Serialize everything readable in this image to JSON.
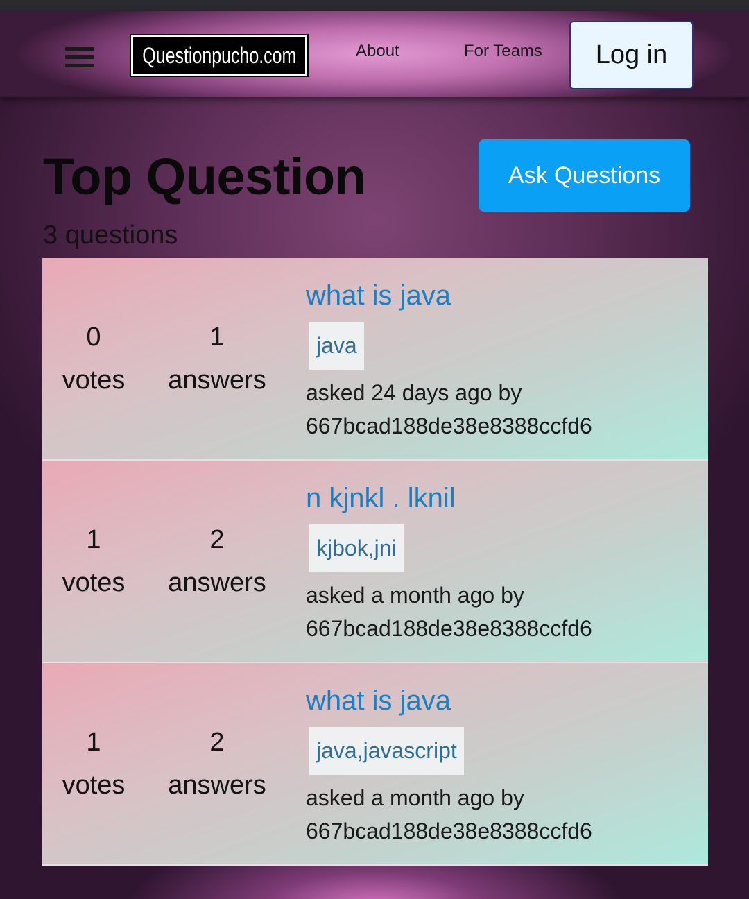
{
  "nav": {
    "logo": "Questionpucho.com",
    "links": [
      "About",
      "For Teams"
    ],
    "login_label": "Log in"
  },
  "main": {
    "title": "Top Question",
    "count_text": "3 questions",
    "ask_label": "Ask Questions"
  },
  "questions": [
    {
      "votes": "0",
      "votes_label": "votes",
      "answers": "1",
      "answers_label": "answers",
      "title": "what is java",
      "tags": "java",
      "asked": "asked 24 days ago by",
      "user": "667bcad188de38e8388ccfd6"
    },
    {
      "votes": "1",
      "votes_label": "votes",
      "answers": "2",
      "answers_label": "answers",
      "title": "n kjnkl . lknil",
      "tags": "kjbok,jni",
      "asked": "asked a month ago by",
      "user": "667bcad188de38e8388ccfd6"
    },
    {
      "votes": "1",
      "votes_label": "votes",
      "answers": "2",
      "answers_label": "answers",
      "title": "what is java",
      "tags": "java,javascript",
      "asked": "asked a month ago by",
      "user": "667bcad188de38e8388ccfd6"
    }
  ],
  "icons": {
    "menu": "hamburger-menu-icon"
  },
  "colors": {
    "ask_button": "#0aa0f5",
    "link": "#1b7fc2",
    "tag_text": "#2f6e96"
  }
}
